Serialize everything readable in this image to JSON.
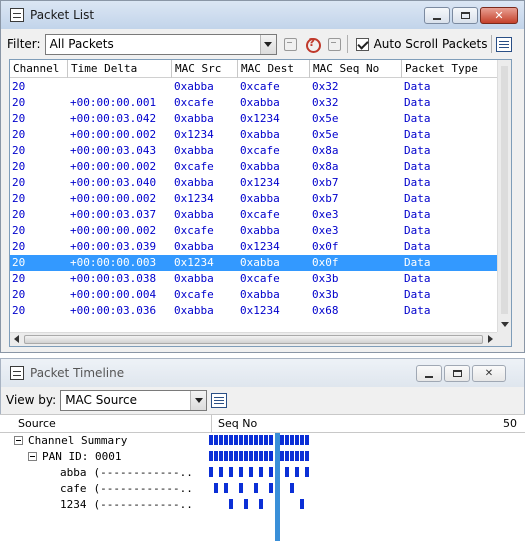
{
  "packet_list": {
    "title": "Packet List",
    "filter_label": "Filter:",
    "filter_value": "All Packets",
    "auto_scroll_label": "Auto Scroll Packets",
    "auto_scroll_checked": true,
    "columns": [
      "Channel",
      "Time Delta",
      "MAC Src",
      "MAC Dest",
      "MAC Seq No",
      "Packet Type"
    ],
    "rows": [
      [
        "20",
        "",
        "0xabba",
        "0xcafe",
        "0x32",
        "Data"
      ],
      [
        "20",
        "+00:00:00.001",
        "0xcafe",
        "0xabba",
        "0x32",
        "Data"
      ],
      [
        "20",
        "+00:00:03.042",
        "0xabba",
        "0x1234",
        "0x5e",
        "Data"
      ],
      [
        "20",
        "+00:00:00.002",
        "0x1234",
        "0xabba",
        "0x5e",
        "Data"
      ],
      [
        "20",
        "+00:00:03.043",
        "0xabba",
        "0xcafe",
        "0x8a",
        "Data"
      ],
      [
        "20",
        "+00:00:00.002",
        "0xcafe",
        "0xabba",
        "0x8a",
        "Data"
      ],
      [
        "20",
        "+00:00:03.040",
        "0xabba",
        "0x1234",
        "0xb7",
        "Data"
      ],
      [
        "20",
        "+00:00:00.002",
        "0x1234",
        "0xabba",
        "0xb7",
        "Data"
      ],
      [
        "20",
        "+00:00:03.037",
        "0xabba",
        "0xcafe",
        "0xe3",
        "Data"
      ],
      [
        "20",
        "+00:00:00.002",
        "0xcafe",
        "0xabba",
        "0xe3",
        "Data"
      ],
      [
        "20",
        "+00:00:03.039",
        "0xabba",
        "0x1234",
        "0x0f",
        "Data"
      ],
      [
        "20",
        "+00:00:00.003",
        "0x1234",
        "0xabba",
        "0x0f",
        "Data"
      ],
      [
        "20",
        "+00:00:03.038",
        "0xabba",
        "0xcafe",
        "0x3b",
        "Data"
      ],
      [
        "20",
        "+00:00:00.004",
        "0xcafe",
        "0xabba",
        "0x3b",
        "Data"
      ],
      [
        "20",
        "+00:00:03.036",
        "0xabba",
        "0x1234",
        "0x68",
        "Data"
      ]
    ],
    "selected_row_index": 11,
    "colors": {
      "row_text": "#0000cc",
      "selection": "#3399ff"
    }
  },
  "packet_timeline": {
    "title": "Packet Timeline",
    "view_by_label": "View by:",
    "view_by_value": "MAC Source",
    "columns": {
      "source": "Source",
      "seq_no": "Seq No",
      "scale_end": "50"
    },
    "tree": [
      {
        "label": "Channel Summary",
        "level": 0,
        "expanded": true,
        "tail": ""
      },
      {
        "label": "PAN ID: 0001",
        "level": 1,
        "expanded": true,
        "tail": ""
      },
      {
        "label": "abba",
        "level": 2,
        "expanded": false,
        "tail": "(------------.."
      },
      {
        "label": "cafe",
        "level": 2,
        "expanded": false,
        "tail": "(------------.."
      },
      {
        "label": "1234",
        "level": 2,
        "expanded": false,
        "tail": "(------------.."
      }
    ],
    "colors": {
      "tick": "#0b2fd6",
      "cursor": "#3a8fd8"
    }
  },
  "icons": {
    "title_bar": "window-list-icon",
    "minimize": "minimize-icon",
    "maximize": "maximize-icon",
    "close": "close-icon",
    "close_glyph": "✕",
    "toolbar": [
      "filter-edit-icon",
      "filter-help-icon",
      "filter-clear-icon",
      "list-view-icon"
    ]
  }
}
